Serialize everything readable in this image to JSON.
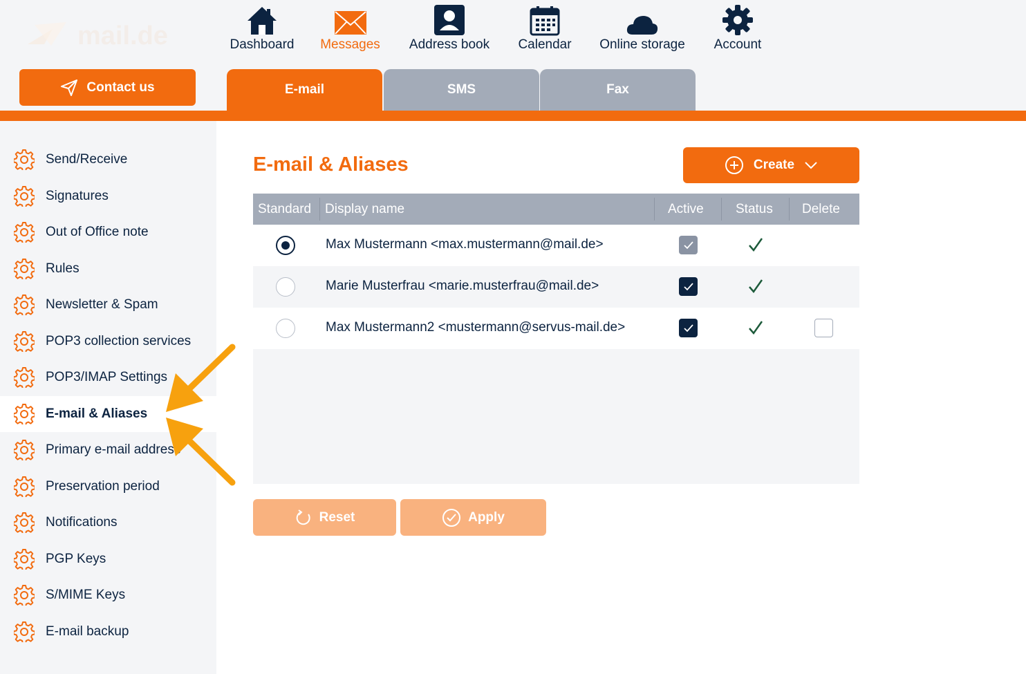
{
  "colors": {
    "accent": "#f26b0f",
    "navy": "#0c2340",
    "tab_inactive": "#a3abb8",
    "annotation_arrow": "#f7a10e"
  },
  "brand": {
    "logo_text": "mail.de"
  },
  "contact": {
    "label": "Contact us",
    "icon": "paper-plane-icon"
  },
  "nav": {
    "items": [
      {
        "label": "Dashboard",
        "icon": "house-icon"
      },
      {
        "label": "Messages",
        "icon": "envelope-icon"
      },
      {
        "label": "Address book",
        "icon": "contact-card-icon"
      },
      {
        "label": "Calendar",
        "icon": "calendar-icon"
      },
      {
        "label": "Online storage",
        "icon": "cloud-icon"
      },
      {
        "label": "Account",
        "icon": "gear-icon"
      }
    ],
    "active": "Messages"
  },
  "tabs": [
    {
      "label": "E-mail"
    },
    {
      "label": "SMS"
    },
    {
      "label": "Fax"
    }
  ],
  "sidebar": {
    "items": [
      {
        "label": "Send/Receive"
      },
      {
        "label": "Signatures"
      },
      {
        "label": "Out of Office note"
      },
      {
        "label": "Rules"
      },
      {
        "label": "Newsletter & Spam"
      },
      {
        "label": "POP3 collection services"
      },
      {
        "label": "POP3/IMAP Settings"
      },
      {
        "label": "E-mail & Aliases"
      },
      {
        "label": "Primary e-mail address"
      },
      {
        "label": "Preservation period"
      },
      {
        "label": "Notifications"
      },
      {
        "label": "PGP Keys"
      },
      {
        "label": "S/MIME Keys"
      },
      {
        "label": "E-mail backup"
      }
    ],
    "active": "E-mail & Aliases"
  },
  "main": {
    "title": "E-mail & Aliases",
    "create_label": "Create",
    "columns": {
      "standard": "Standard",
      "display_name": "Display name",
      "active": "Active",
      "status": "Status",
      "delete": "Delete"
    },
    "rows": [
      {
        "display_name": "Max Mustermann <max.mustermann@mail.de>",
        "standard": true,
        "active": true,
        "active_disabled": true,
        "status_ok": true,
        "deletable": false
      },
      {
        "display_name": "Marie Musterfrau <marie.musterfrau@mail.de>",
        "standard": false,
        "active": true,
        "active_disabled": false,
        "status_ok": true,
        "deletable": false
      },
      {
        "display_name": "Max Mustermann2 <mustermann@servus-mail.de>",
        "standard": false,
        "active": true,
        "active_disabled": false,
        "status_ok": true,
        "deletable": true
      }
    ],
    "reset_label": "Reset",
    "apply_label": "Apply"
  }
}
